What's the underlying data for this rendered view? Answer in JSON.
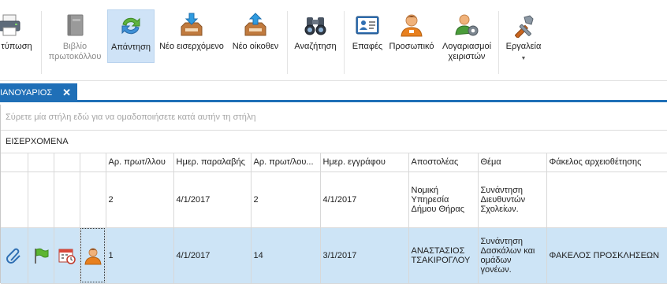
{
  "ribbon": {
    "buttons": [
      {
        "id": "print",
        "label": "τύπωση",
        "icon": "printer-icon"
      },
      {
        "id": "book",
        "label": "Βιβλίο πρωτοκόλλου",
        "icon": "book-icon",
        "disabled": true
      },
      {
        "id": "reply",
        "label": "Απάντηση",
        "icon": "reply-arrows-icon",
        "active": true
      },
      {
        "id": "new_incoming",
        "label": "Νέο εισερχόμενο",
        "icon": "inbox-down-icon"
      },
      {
        "id": "new_outgoing",
        "label": "Νέο οίκοθεν",
        "icon": "inbox-up-icon"
      },
      {
        "id": "search",
        "label": "Αναζήτηση",
        "icon": "binoculars-icon"
      },
      {
        "id": "contacts",
        "label": "Επαφές",
        "icon": "contact-card-icon"
      },
      {
        "id": "personnel",
        "label": "Προσωπικό",
        "icon": "person-icon"
      },
      {
        "id": "user_accounts",
        "label": "Λογαριασμοί χειριστών",
        "icon": "users-gear-icon"
      },
      {
        "id": "tools",
        "label": "Εργαλεία",
        "icon": "tools-icon"
      }
    ]
  },
  "tab": {
    "label": "ΙΑΝΟΥΑΡΙΟΣ",
    "close": "✕"
  },
  "grid": {
    "group_panel_text": "Σύρετε μία στήλη εδώ για να ομαδοποιήσετε κατά αυτήν τη στήλη",
    "group_name": "ΕΙΣΕΡΧΟΜΕΝΑ",
    "columns": [
      "",
      "",
      "",
      "",
      "Αρ. πρωτ/λλου",
      "Ημερ. παραλαβής",
      "Αρ. πρωτ/λου...",
      "Ημερ. εγγράφου",
      "Αποστολέας",
      "Θέμα",
      "Φάκελος αρχειοθέτησης"
    ],
    "rows": [
      {
        "cells": [
          "2",
          "4/1/2017",
          "2",
          "4/1/2017",
          "Νομική Υπηρεσία Δήμου Θήρας",
          "Συνάντηση Διευθυντών Σχολείων.",
          ""
        ]
      },
      {
        "cells": [
          "1",
          "4/1/2017",
          "14",
          "3/1/2017",
          "ΑΝΑΣΤΑΣΙΟΣ ΤΣΑΚΙΡΟΓΛΟΥ",
          "Συνάντηση Δασκάλων και ομάδων γονέων.",
          "ΦΑΚΕΛΟΣ ΠΡΟΣΚΛΗΣΕΩΝ"
        ],
        "icons": [
          "paperclip-icon",
          "flag-icon",
          "calendar-icon",
          "person-icon"
        ]
      }
    ]
  },
  "colors": {
    "accent": "#1f6fb7",
    "selected_row": "#cde4f6",
    "active_button": "#cfe3f7"
  }
}
